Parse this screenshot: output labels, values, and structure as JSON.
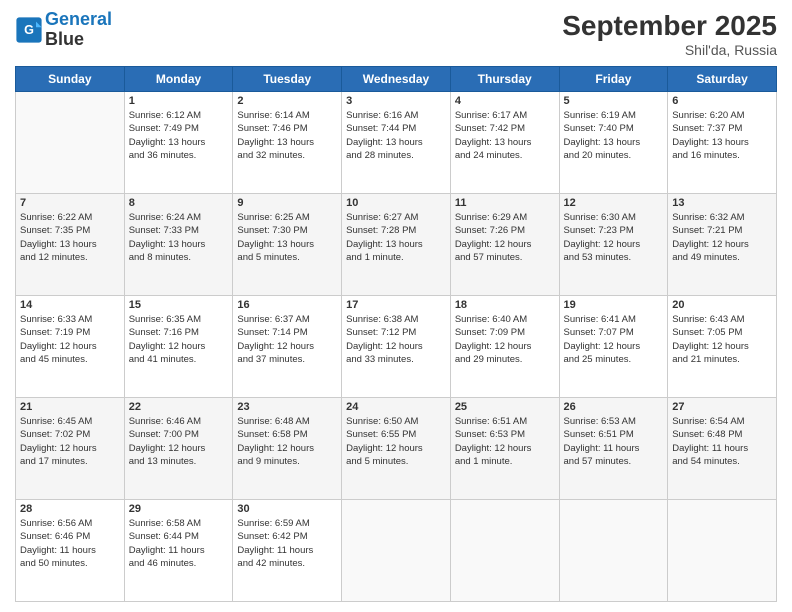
{
  "header": {
    "logo_line1": "General",
    "logo_line2": "Blue",
    "month_title": "September 2025",
    "location": "Shil'da, Russia"
  },
  "days_of_week": [
    "Sunday",
    "Monday",
    "Tuesday",
    "Wednesday",
    "Thursday",
    "Friday",
    "Saturday"
  ],
  "weeks": [
    [
      {
        "day": "",
        "info": ""
      },
      {
        "day": "1",
        "info": "Sunrise: 6:12 AM\nSunset: 7:49 PM\nDaylight: 13 hours\nand 36 minutes."
      },
      {
        "day": "2",
        "info": "Sunrise: 6:14 AM\nSunset: 7:46 PM\nDaylight: 13 hours\nand 32 minutes."
      },
      {
        "day": "3",
        "info": "Sunrise: 6:16 AM\nSunset: 7:44 PM\nDaylight: 13 hours\nand 28 minutes."
      },
      {
        "day": "4",
        "info": "Sunrise: 6:17 AM\nSunset: 7:42 PM\nDaylight: 13 hours\nand 24 minutes."
      },
      {
        "day": "5",
        "info": "Sunrise: 6:19 AM\nSunset: 7:40 PM\nDaylight: 13 hours\nand 20 minutes."
      },
      {
        "day": "6",
        "info": "Sunrise: 6:20 AM\nSunset: 7:37 PM\nDaylight: 13 hours\nand 16 minutes."
      }
    ],
    [
      {
        "day": "7",
        "info": "Sunrise: 6:22 AM\nSunset: 7:35 PM\nDaylight: 13 hours\nand 12 minutes."
      },
      {
        "day": "8",
        "info": "Sunrise: 6:24 AM\nSunset: 7:33 PM\nDaylight: 13 hours\nand 8 minutes."
      },
      {
        "day": "9",
        "info": "Sunrise: 6:25 AM\nSunset: 7:30 PM\nDaylight: 13 hours\nand 5 minutes."
      },
      {
        "day": "10",
        "info": "Sunrise: 6:27 AM\nSunset: 7:28 PM\nDaylight: 13 hours\nand 1 minute."
      },
      {
        "day": "11",
        "info": "Sunrise: 6:29 AM\nSunset: 7:26 PM\nDaylight: 12 hours\nand 57 minutes."
      },
      {
        "day": "12",
        "info": "Sunrise: 6:30 AM\nSunset: 7:23 PM\nDaylight: 12 hours\nand 53 minutes."
      },
      {
        "day": "13",
        "info": "Sunrise: 6:32 AM\nSunset: 7:21 PM\nDaylight: 12 hours\nand 49 minutes."
      }
    ],
    [
      {
        "day": "14",
        "info": "Sunrise: 6:33 AM\nSunset: 7:19 PM\nDaylight: 12 hours\nand 45 minutes."
      },
      {
        "day": "15",
        "info": "Sunrise: 6:35 AM\nSunset: 7:16 PM\nDaylight: 12 hours\nand 41 minutes."
      },
      {
        "day": "16",
        "info": "Sunrise: 6:37 AM\nSunset: 7:14 PM\nDaylight: 12 hours\nand 37 minutes."
      },
      {
        "day": "17",
        "info": "Sunrise: 6:38 AM\nSunset: 7:12 PM\nDaylight: 12 hours\nand 33 minutes."
      },
      {
        "day": "18",
        "info": "Sunrise: 6:40 AM\nSunset: 7:09 PM\nDaylight: 12 hours\nand 29 minutes."
      },
      {
        "day": "19",
        "info": "Sunrise: 6:41 AM\nSunset: 7:07 PM\nDaylight: 12 hours\nand 25 minutes."
      },
      {
        "day": "20",
        "info": "Sunrise: 6:43 AM\nSunset: 7:05 PM\nDaylight: 12 hours\nand 21 minutes."
      }
    ],
    [
      {
        "day": "21",
        "info": "Sunrise: 6:45 AM\nSunset: 7:02 PM\nDaylight: 12 hours\nand 17 minutes."
      },
      {
        "day": "22",
        "info": "Sunrise: 6:46 AM\nSunset: 7:00 PM\nDaylight: 12 hours\nand 13 minutes."
      },
      {
        "day": "23",
        "info": "Sunrise: 6:48 AM\nSunset: 6:58 PM\nDaylight: 12 hours\nand 9 minutes."
      },
      {
        "day": "24",
        "info": "Sunrise: 6:50 AM\nSunset: 6:55 PM\nDaylight: 12 hours\nand 5 minutes."
      },
      {
        "day": "25",
        "info": "Sunrise: 6:51 AM\nSunset: 6:53 PM\nDaylight: 12 hours\nand 1 minute."
      },
      {
        "day": "26",
        "info": "Sunrise: 6:53 AM\nSunset: 6:51 PM\nDaylight: 11 hours\nand 57 minutes."
      },
      {
        "day": "27",
        "info": "Sunrise: 6:54 AM\nSunset: 6:48 PM\nDaylight: 11 hours\nand 54 minutes."
      }
    ],
    [
      {
        "day": "28",
        "info": "Sunrise: 6:56 AM\nSunset: 6:46 PM\nDaylight: 11 hours\nand 50 minutes."
      },
      {
        "day": "29",
        "info": "Sunrise: 6:58 AM\nSunset: 6:44 PM\nDaylight: 11 hours\nand 46 minutes."
      },
      {
        "day": "30",
        "info": "Sunrise: 6:59 AM\nSunset: 6:42 PM\nDaylight: 11 hours\nand 42 minutes."
      },
      {
        "day": "",
        "info": ""
      },
      {
        "day": "",
        "info": ""
      },
      {
        "day": "",
        "info": ""
      },
      {
        "day": "",
        "info": ""
      }
    ]
  ]
}
